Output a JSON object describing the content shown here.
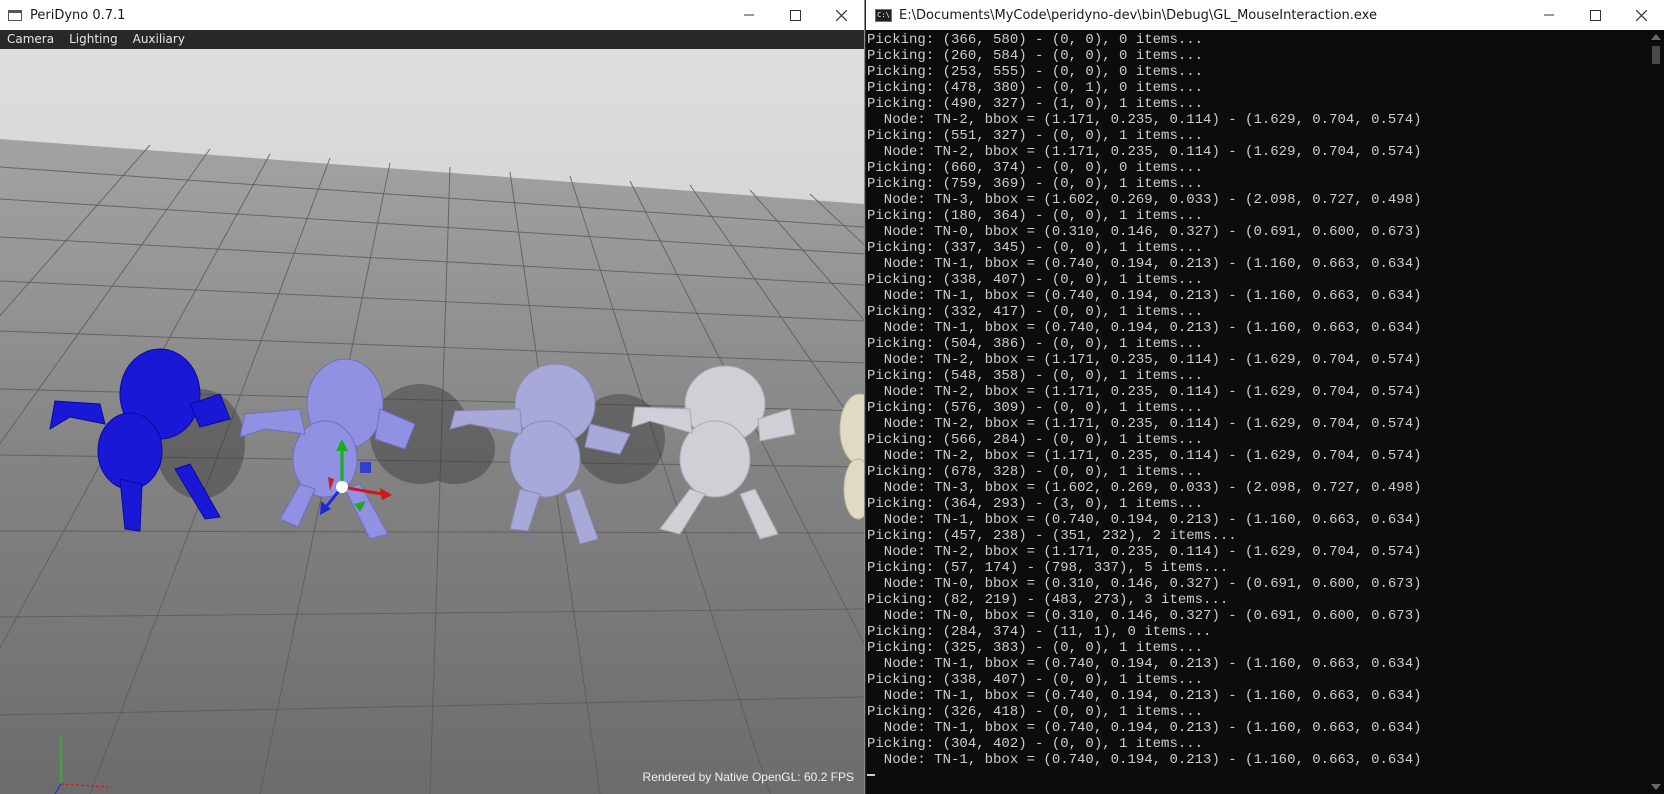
{
  "app_window": {
    "title": "PeriDyno 0.7.1",
    "menu": [
      "Camera",
      "Lighting",
      "Auxiliary"
    ],
    "fps_text": "Rendered by Native OpenGL: 60.2 FPS",
    "colors": {
      "selected_model": "#1a1ad6",
      "highlight_model": "#8c8ce0"
    }
  },
  "console_window": {
    "title": "E:\\Documents\\MyCode\\peridyno-dev\\bin\\Debug\\GL_MouseInteraction.exe",
    "icon_text": "C:\\",
    "lines": [
      "Picking: (366, 580) - (0, 0), 0 items...",
      "Picking: (260, 584) - (0, 0), 0 items...",
      "Picking: (253, 555) - (0, 0), 0 items...",
      "Picking: (478, 380) - (0, 1), 0 items...",
      "Picking: (490, 327) - (1, 0), 1 items...",
      "  Node: TN-2, bbox = (1.171, 0.235, 0.114) - (1.629, 0.704, 0.574)",
      "Picking: (551, 327) - (0, 0), 1 items...",
      "  Node: TN-2, bbox = (1.171, 0.235, 0.114) - (1.629, 0.704, 0.574)",
      "Picking: (660, 374) - (0, 0), 0 items...",
      "Picking: (759, 369) - (0, 0), 1 items...",
      "  Node: TN-3, bbox = (1.602, 0.269, 0.033) - (2.098, 0.727, 0.498)",
      "Picking: (180, 364) - (0, 0), 1 items...",
      "  Node: TN-0, bbox = (0.310, 0.146, 0.327) - (0.691, 0.600, 0.673)",
      "Picking: (337, 345) - (0, 0), 1 items...",
      "  Node: TN-1, bbox = (0.740, 0.194, 0.213) - (1.160, 0.663, 0.634)",
      "Picking: (338, 407) - (0, 0), 1 items...",
      "  Node: TN-1, bbox = (0.740, 0.194, 0.213) - (1.160, 0.663, 0.634)",
      "Picking: (332, 417) - (0, 0), 1 items...",
      "  Node: TN-1, bbox = (0.740, 0.194, 0.213) - (1.160, 0.663, 0.634)",
      "Picking: (504, 386) - (0, 0), 1 items...",
      "  Node: TN-2, bbox = (1.171, 0.235, 0.114) - (1.629, 0.704, 0.574)",
      "Picking: (548, 358) - (0, 0), 1 items...",
      "  Node: TN-2, bbox = (1.171, 0.235, 0.114) - (1.629, 0.704, 0.574)",
      "Picking: (576, 309) - (0, 0), 1 items...",
      "  Node: TN-2, bbox = (1.171, 0.235, 0.114) - (1.629, 0.704, 0.574)",
      "Picking: (566, 284) - (0, 0), 1 items...",
      "  Node: TN-2, bbox = (1.171, 0.235, 0.114) - (1.629, 0.704, 0.574)",
      "Picking: (678, 328) - (0, 0), 1 items...",
      "  Node: TN-3, bbox = (1.602, 0.269, 0.033) - (2.098, 0.727, 0.498)",
      "Picking: (364, 293) - (3, 0), 1 items...",
      "  Node: TN-1, bbox = (0.740, 0.194, 0.213) - (1.160, 0.663, 0.634)",
      "Picking: (457, 238) - (351, 232), 2 items...",
      "  Node: TN-2, bbox = (1.171, 0.235, 0.114) - (1.629, 0.704, 0.574)",
      "Picking: (57, 174) - (798, 337), 5 items...",
      "  Node: TN-0, bbox = (0.310, 0.146, 0.327) - (0.691, 0.600, 0.673)",
      "Picking: (82, 219) - (483, 273), 3 items...",
      "  Node: TN-0, bbox = (0.310, 0.146, 0.327) - (0.691, 0.600, 0.673)",
      "Picking: (284, 374) - (11, 1), 0 items...",
      "Picking: (325, 383) - (0, 0), 1 items...",
      "  Node: TN-1, bbox = (0.740, 0.194, 0.213) - (1.160, 0.663, 0.634)",
      "Picking: (338, 407) - (0, 0), 1 items...",
      "  Node: TN-1, bbox = (0.740, 0.194, 0.213) - (1.160, 0.663, 0.634)",
      "Picking: (326, 418) - (0, 0), 1 items...",
      "  Node: TN-1, bbox = (0.740, 0.194, 0.213) - (1.160, 0.663, 0.634)",
      "Picking: (304, 402) - (0, 0), 1 items...",
      "  Node: TN-1, bbox = (0.740, 0.194, 0.213) - (1.160, 0.663, 0.634)"
    ]
  }
}
